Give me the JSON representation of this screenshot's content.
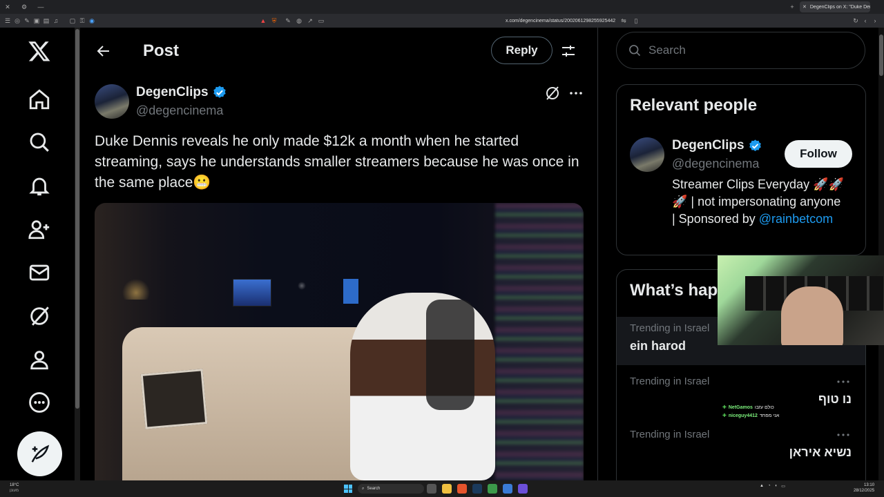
{
  "browser": {
    "tab_title": "DegenClips on X: \"Duke Dennis",
    "url": "x.com/degencinema/status/2002061298255925442"
  },
  "header": {
    "title": "Post",
    "reply_label": "Reply"
  },
  "tweet": {
    "author_name": "DegenClips",
    "author_handle": "@degencinema",
    "text": "Duke Dennis reveals he only made $12k a month when he started streaming, says he understands smaller streamers because he was once in the same place😬"
  },
  "search": {
    "placeholder": "Search"
  },
  "relevant": {
    "heading": "Relevant people",
    "name": "DegenClips",
    "handle": "@degencinema",
    "follow_label": "Follow",
    "bio": "Streamer Clips Everyday 🚀🚀🚀 | not impersonating anyone | Sponsored by",
    "bio_link": "@rainbetcom"
  },
  "whats_happening": {
    "heading": "What’s happening",
    "trends": [
      {
        "context": "Trending in Israel",
        "topic": "ein harod"
      },
      {
        "context": "Trending in Israel",
        "topic": "נו טוף"
      },
      {
        "context": "Trending in Israel",
        "topic": "נשיא איראן"
      }
    ]
  },
  "stream_chat": [
    {
      "user": "NetGamos",
      "message": "כולם עזבו"
    },
    {
      "user": "niceguy4412",
      "message": "אני מפחד"
    }
  ],
  "taskbar": {
    "weather_temp": "18°C",
    "weather_desc": "מעונן",
    "search_label": "Search",
    "time": "13:10",
    "date": "28/12/2025"
  },
  "colors": {
    "accent": "#1d9bf0",
    "background": "#000000",
    "text": "#e7e9ea",
    "muted": "#71767b"
  }
}
